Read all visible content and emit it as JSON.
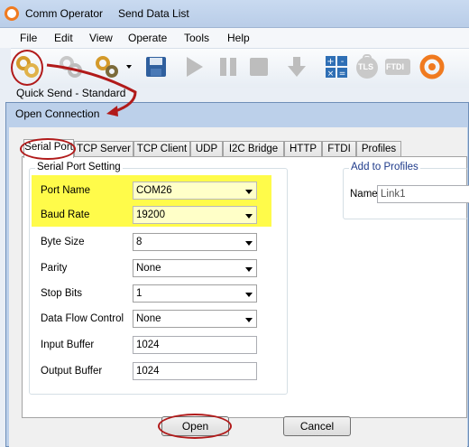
{
  "app": {
    "title": "Comm Operator",
    "document": "Send Data List"
  },
  "menu": [
    "File",
    "Edit",
    "View",
    "Operate",
    "Tools",
    "Help"
  ],
  "toolbar": {
    "quick_send_label": "Quick Send - Standard",
    "icons": [
      "quick-send-icon",
      "connect-icon",
      "disconnect-icon",
      "save-icon",
      "play-icon",
      "pause-icon",
      "stop-icon",
      "download-icon",
      "calculator-icon",
      "tls-icon",
      "ftdi-icon",
      "app-logo-icon"
    ],
    "tls_label": "TLS",
    "ftdi_label": "FTDI",
    "accent": "#f07a1f"
  },
  "dialog": {
    "title": "Open Connection",
    "tabs": [
      "Serial Port",
      "TCP Server",
      "TCP Client",
      "UDP",
      "I2C Bridge",
      "HTTP",
      "FTDI",
      "Profiles"
    ],
    "active_tab": "Serial Port",
    "serial_group": {
      "caption": "Serial Port Setting",
      "fields": [
        {
          "label": "Port Name",
          "value": "COM26",
          "kind": "combo"
        },
        {
          "label": "Baud Rate",
          "value": "19200",
          "kind": "combo"
        },
        {
          "label": "Byte Size",
          "value": "8",
          "kind": "combo"
        },
        {
          "label": "Parity",
          "value": "None",
          "kind": "combo"
        },
        {
          "label": "Stop Bits",
          "value": "1",
          "kind": "combo"
        },
        {
          "label": "Data Flow Control",
          "value": "None",
          "kind": "combo"
        },
        {
          "label": "Input Buffer",
          "value": "1024",
          "kind": "text"
        },
        {
          "label": "Output Buffer",
          "value": "1024",
          "kind": "text"
        }
      ]
    },
    "profile_group": {
      "caption": "Add to Profiles",
      "name_label": "Name",
      "name_value": "Link1"
    },
    "open_button": "Open",
    "cancel_button": "Cancel",
    "highlight_color": "#fffb4a",
    "annotation_color": "#b11a1a"
  }
}
